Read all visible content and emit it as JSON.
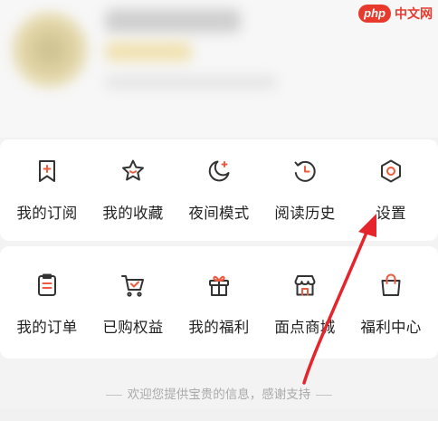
{
  "watermark": {
    "logo": "php",
    "text": "中文网"
  },
  "row1": [
    {
      "label": "我的订阅",
      "icon": "bookmark-plus-icon"
    },
    {
      "label": "我的收藏",
      "icon": "star-face-icon"
    },
    {
      "label": "夜间模式",
      "icon": "moon-icon"
    },
    {
      "label": "阅读历史",
      "icon": "history-clock-icon"
    },
    {
      "label": "设置",
      "icon": "gear-icon"
    }
  ],
  "row2": [
    {
      "label": "我的订单",
      "icon": "order-clipboard-icon"
    },
    {
      "label": "已购权益",
      "icon": "cart-check-icon"
    },
    {
      "label": "我的福利",
      "icon": "gift-icon"
    },
    {
      "label": "面点商城",
      "icon": "store-icon"
    },
    {
      "label": "福利中心",
      "icon": "shopping-bag-icon"
    }
  ],
  "footer": "欢迎您提供宝贵的信息，感谢支持",
  "colors": {
    "accent_red": "#e8392d",
    "icon_stroke": "#333333",
    "icon_accent": "#f05a3c",
    "arrow": "#e5242b"
  }
}
